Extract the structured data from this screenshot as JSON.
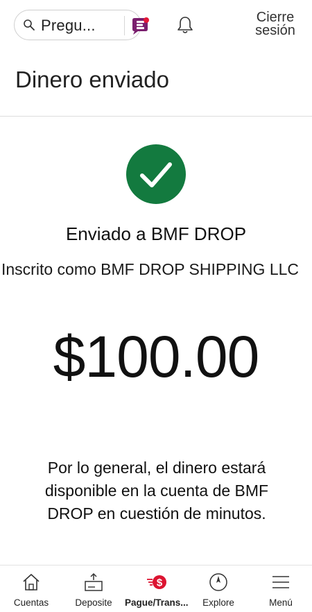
{
  "header": {
    "search_placeholder": "Pregu...",
    "signout_line1": "Cierre",
    "signout_line2": "sesión"
  },
  "page": {
    "title": "Dinero enviado"
  },
  "confirmation": {
    "sent_to": "Enviado a BMF DROP",
    "enrolled_as": "Inscrito como BMF DROP SHIPPING LLC",
    "amount": "$100.00",
    "note": "Por lo general, el dinero estará disponible en la cuenta de BMF DROP en cuestión de minutos.",
    "success_color": "#137a3f"
  },
  "bottom_nav": {
    "items": [
      {
        "label": "Cuentas",
        "icon": "home-icon"
      },
      {
        "label": "Deposite",
        "icon": "deposit-check-icon"
      },
      {
        "label": "Pague/Trans...",
        "icon": "pay-transfer-icon",
        "active": true
      },
      {
        "label": "Explore",
        "icon": "compass-icon"
      },
      {
        "label": "Menú",
        "icon": "menu-icon"
      }
    ],
    "accent_color": "#dc1431"
  }
}
